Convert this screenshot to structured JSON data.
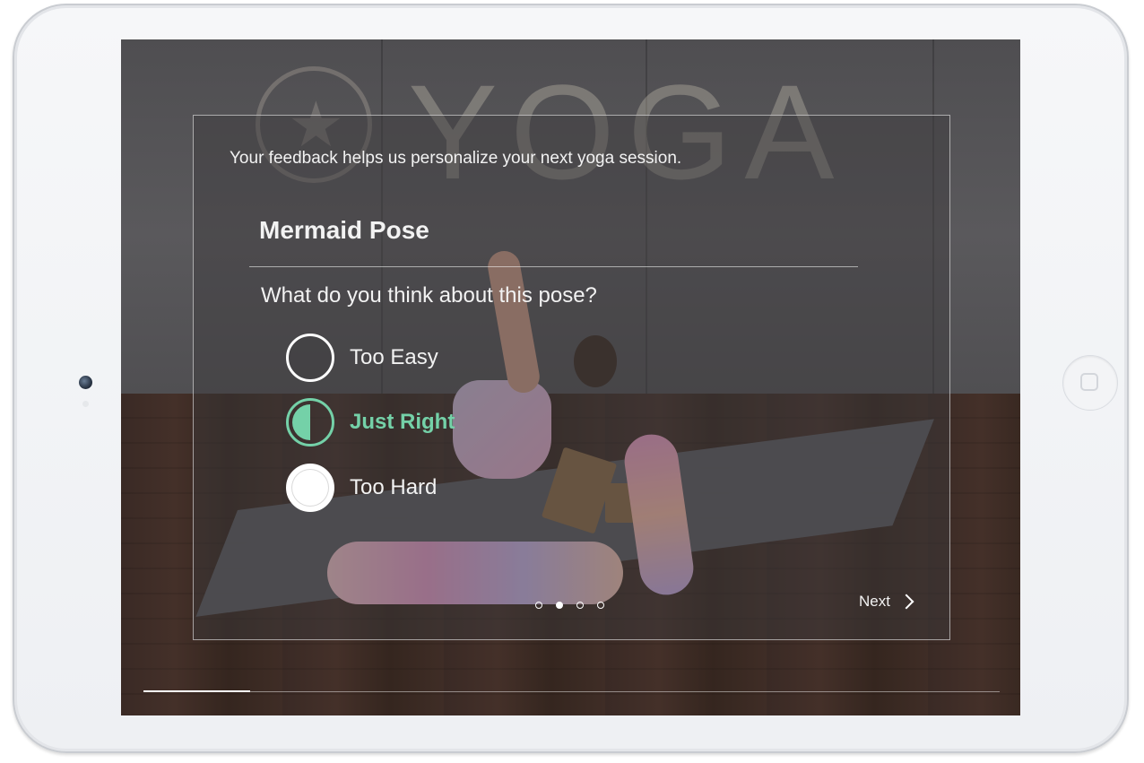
{
  "screen": {
    "background_sign": "YOGA"
  },
  "feedback": {
    "intro": "Your feedback helps us personalize your next yoga session.",
    "pose_title": "Mermaid Pose",
    "question": "What do you think about this pose?",
    "options": [
      {
        "label": "Too Easy",
        "state": "empty"
      },
      {
        "label": "Just Right",
        "state": "selected"
      },
      {
        "label": "Too Hard",
        "state": "filled"
      }
    ],
    "pagination": {
      "total": 4,
      "current": 2
    },
    "next_label": "Next"
  },
  "progress": {
    "fraction": 0.125
  },
  "colors": {
    "accent": "#74d1a8"
  }
}
